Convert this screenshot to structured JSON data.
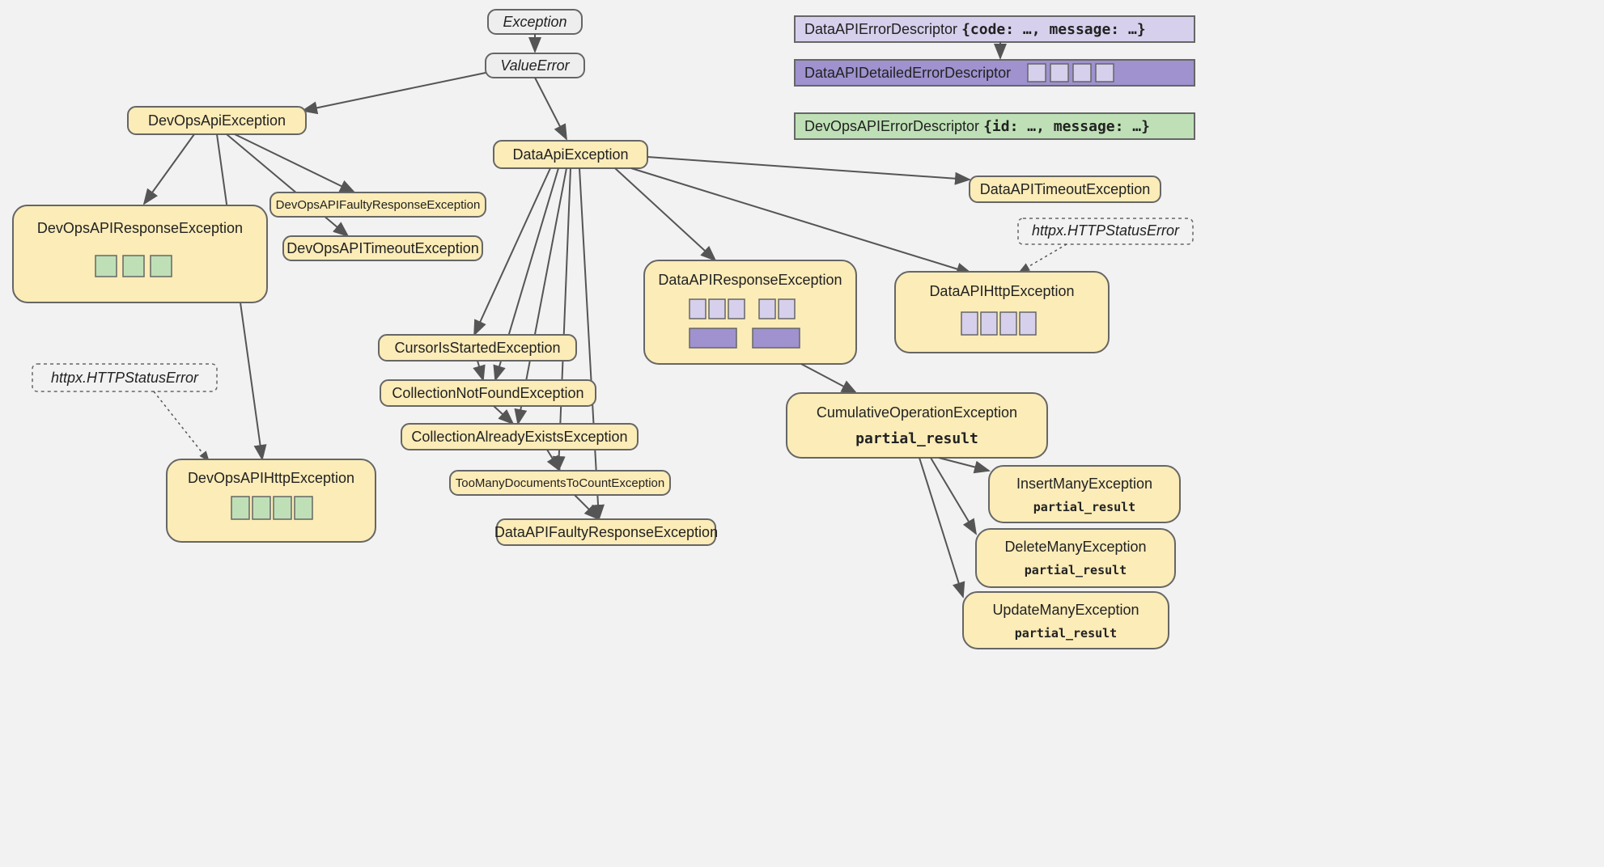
{
  "nodes": {
    "exception": "Exception",
    "valueerror": "ValueError",
    "devopsapi": "DevOpsApiException",
    "dataapi": "DataApiException",
    "devopsresp": "DevOpsAPIResponseException",
    "devopsfaulty": "DevOpsAPIFaultyResponseException",
    "devopstimeout": "DevOpsAPITimeoutException",
    "devopshttp": "DevOpsAPIHttpException",
    "datatimeout": "DataAPITimeoutException",
    "dataresp": "DataAPIResponseException",
    "datahttp": "DataAPIHttpException",
    "cursor": "CursorIsStartedException",
    "collnf": "CollectionNotFoundException",
    "collae": "CollectionAlreadyExistsException",
    "toomany": "TooManyDocumentsToCountException",
    "datafaulty": "DataAPIFaultyResponseException",
    "cumop": "CumulativeOperationException",
    "insertmany": "InsertManyException",
    "deletemany": "DeleteManyException",
    "updatemany": "UpdateManyException"
  },
  "partial_result": "partial_result",
  "httpx": "httpx.HTTPStatusError",
  "legend": {
    "dataerr": "DataAPIErrorDescriptor",
    "dataerr_detail": "{code: …, message: …}",
    "datadet": "DataAPIDetailedErrorDescriptor",
    "devopserr": "DevOpsAPIErrorDescriptor",
    "devopserr_detail": "{id: …, message: …}"
  }
}
